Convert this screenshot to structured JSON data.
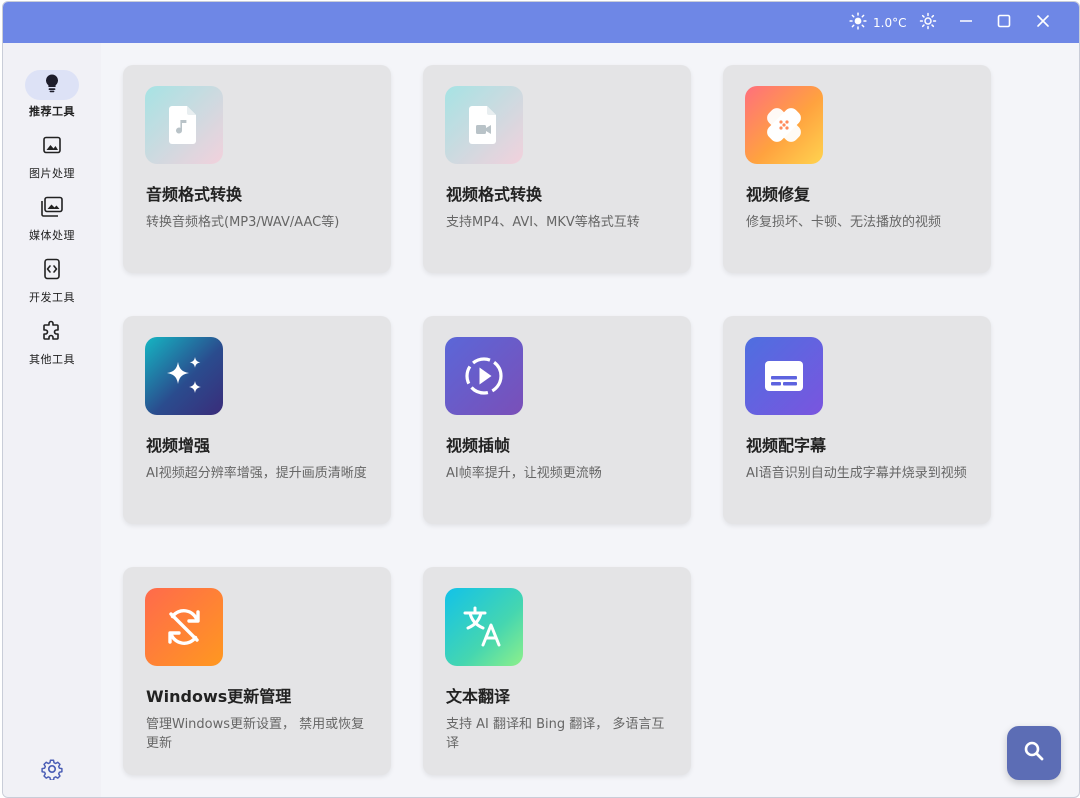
{
  "titlebar": {
    "weather_text": "1.0°C",
    "bg_color": "#6e87e6",
    "icons": [
      "sun-icon",
      "brightness-icon",
      "minimize-icon",
      "maximize-icon",
      "close-icon"
    ]
  },
  "sidebar": {
    "items": [
      {
        "label": "推荐工具",
        "icon": "lightbulb-icon",
        "active": true
      },
      {
        "label": "图片处理",
        "icon": "image-icon",
        "active": false
      },
      {
        "label": "媒体处理",
        "icon": "media-icon",
        "active": false
      },
      {
        "label": "开发工具",
        "icon": "code-icon",
        "active": false
      },
      {
        "label": "其他工具",
        "icon": "puzzle-icon",
        "active": false
      }
    ],
    "settings_icon": "gear-icon",
    "active_color": "#dde2f6"
  },
  "cards": [
    {
      "title": "音频格式转换",
      "desc": "转换音频格式(MP3/WAV/AAC等)",
      "icon": "audio-file-icon"
    },
    {
      "title": "视频格式转换",
      "desc": "支持MP4、AVI、MKV等格式互转",
      "icon": "video-file-icon"
    },
    {
      "title": "视频修复",
      "desc": "修复损坏、卡顿、无法播放的视频",
      "icon": "bandage-icon"
    },
    {
      "title": "视频增强",
      "desc": "AI视频超分辨率增强，提升画质清晰度",
      "icon": "sparkle-icon"
    },
    {
      "title": "视频插帧",
      "desc": "AI帧率提升，让视频更流畅",
      "icon": "play-circle-icon"
    },
    {
      "title": "视频配字幕",
      "desc": "AI语音识别自动生成字幕并烧录到视频",
      "icon": "subtitles-icon"
    },
    {
      "title": "Windows更新管理",
      "desc": "管理Windows更新设置， 禁用或恢复更新",
      "icon": "update-off-icon"
    },
    {
      "title": "文本翻译",
      "desc": "支持 AI 翻译和 Bing 翻译， 多语言互译",
      "icon": "translate-icon"
    }
  ],
  "fab": {
    "icon": "search-icon",
    "color": "#5c6db5"
  }
}
